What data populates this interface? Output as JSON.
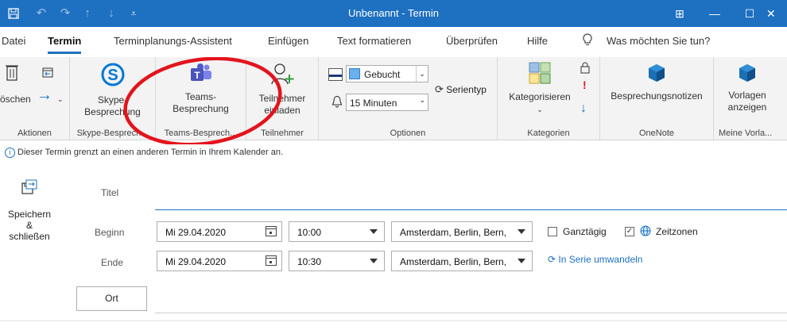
{
  "window": {
    "title": "Unbenannt - Termin",
    "controls": {
      "ribbon_display": "⊞",
      "minimize": "—",
      "maximize": "☐",
      "close": "✕"
    }
  },
  "quick_access": {
    "save_icon": "save-icon",
    "undo": "↶",
    "redo": "↷",
    "up": "↑",
    "down": "↓",
    "customize": "⩡"
  },
  "menu": {
    "tabs": [
      "Datei",
      "Termin",
      "Terminplanungs-Assistent",
      "Einfügen",
      "Text formatieren",
      "Überprüfen",
      "Hilfe"
    ],
    "active": "Termin",
    "search_placeholder": "Was möchten Sie tun?"
  },
  "ribbon": {
    "aktionen": {
      "delete_label": "öschen",
      "forward_label": "→",
      "group_label": "Aktionen"
    },
    "skype": {
      "button_line1": "Skype-",
      "button_line2": "Besprechung",
      "group_label": "Skype-Besprech..."
    },
    "teams": {
      "button_line1": "Teams-",
      "button_line2": "Besprechung",
      "group_label": "Teams-Besprech..."
    },
    "teilnehmer": {
      "button_line1": "Teilnehmer",
      "button_line2": "einladen",
      "group_label": "Teilnehmer"
    },
    "optionen": {
      "show_as": "Gebucht",
      "reminder": "15 Minuten",
      "recurrence_label": "Serientyp",
      "group_label": "Optionen"
    },
    "kategorien": {
      "button_label": "Kategorisieren",
      "group_label": "Kategorien"
    },
    "onenote": {
      "button_label": "Besprechungsnotizen",
      "group_label": "OneNote"
    },
    "vorlagen": {
      "button_line1": "Vorlagen",
      "button_line2": "anzeigen",
      "group_label": "Meine Vorla..."
    }
  },
  "info_message": "Dieser Termin grenzt an einen anderen Termin in Ihrem Kalender an.",
  "form": {
    "save_close_line1": "Speichern",
    "save_close_line2": "&",
    "save_close_line3": "schließen",
    "title_label": "Titel",
    "title_value": "",
    "start_label": "Beginn",
    "start_date": "Mi 29.04.2020",
    "start_time": "10:00",
    "start_timezone": "Amsterdam, Berlin, Bern,",
    "end_label": "Ende",
    "end_date": "Mi 29.04.2020",
    "end_time": "10:30",
    "end_timezone": "Amsterdam, Berlin, Bern,",
    "allday_label": "Ganztägig",
    "allday_checked": false,
    "timezones_label": "Zeitzonen",
    "timezones_checked": true,
    "recurrence_link": "In Serie umwandeln",
    "location_button": "Ort",
    "location_value": ""
  },
  "colors": {
    "accent": "#1e70c1",
    "annotation_circle": "#e3141c",
    "teams": "#4b53bc",
    "skype": "#0078d4"
  }
}
